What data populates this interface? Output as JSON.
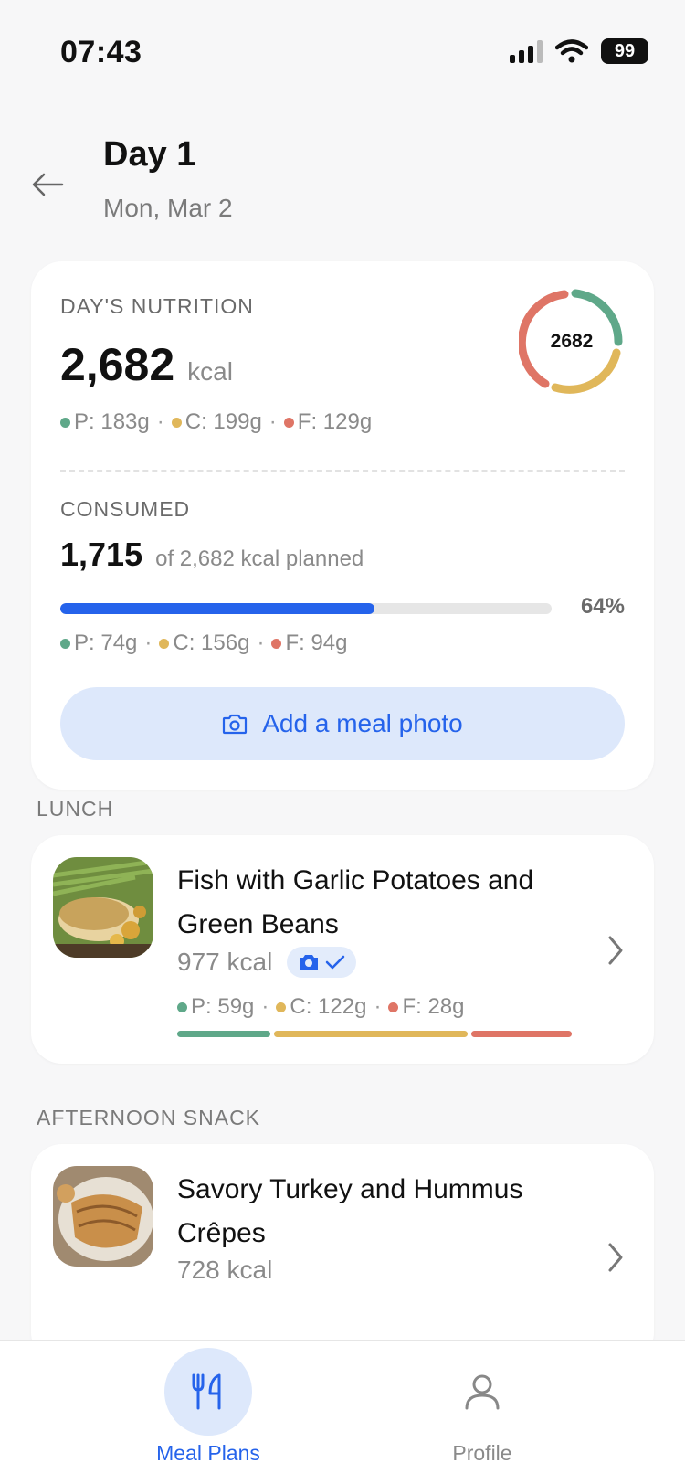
{
  "status_bar": {
    "time": "07:43",
    "battery": "99"
  },
  "header": {
    "title": "Day 1",
    "date": "Mon, Mar 2"
  },
  "nutrition": {
    "title": "DAY'S NUTRITION",
    "kcal": "2,682",
    "kcal_unit": "kcal",
    "ring_label": "2682",
    "macros": {
      "p": "P: 183g",
      "c": "C: 199g",
      "f": "F: 129g"
    },
    "consumed_title": "CONSUMED",
    "consumed_kcal": "1,715",
    "consumed_sub": "of 2,682 kcal planned",
    "progress_pct": "64%",
    "progress_value": 0.64,
    "consumed_macros": {
      "p": "P: 74g",
      "c": "C: 156g",
      "f": "F: 94g"
    },
    "photo_button": "Add a meal photo"
  },
  "meals": [
    {
      "section": "LUNCH",
      "name": "Fish with Garlic Potatoes and Green Beans",
      "kcal": "977 kcal",
      "macros": {
        "p": "P: 59g",
        "c": "C: 122g",
        "f": "F: 28g"
      }
    },
    {
      "section": "AFTERNOON SNACK",
      "name": "Savory Turkey and Hummus Crêpes",
      "kcal": "728 kcal"
    }
  ],
  "nav": {
    "meal_plans": "Meal Plans",
    "profile": "Profile"
  },
  "colors": {
    "protein": "#5fa889",
    "carbs": "#e0b75a",
    "fat": "#df7566",
    "accent": "#2563eb"
  },
  "icons": [
    "back-arrow-icon",
    "camera-icon",
    "check-icon",
    "chevron-right-icon",
    "fork-knife-icon",
    "person-icon"
  ]
}
